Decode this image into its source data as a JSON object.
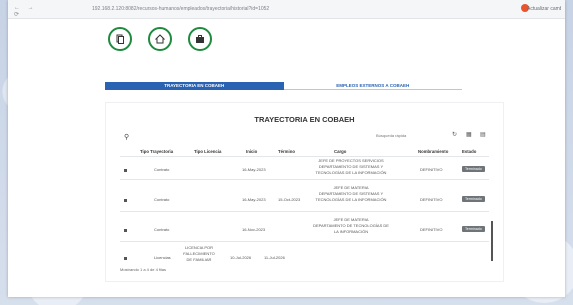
{
  "browser": {
    "nav_glyphs": "← → ⟳",
    "url": "192.168.2.120:8082/recursos-humanos/empleados/trayectoria/historial?id=1052",
    "profile_name": "Actualizar cambios"
  },
  "top_icons": [
    {
      "name": "document-icon",
      "glyph": "⎘"
    },
    {
      "name": "home-icon",
      "glyph": "⌂"
    },
    {
      "name": "briefcase-icon",
      "glyph": "▣"
    }
  ],
  "tabs": [
    {
      "label": "TRAYECTORIA EN COBAEH",
      "active": true
    },
    {
      "label": "EMPLEOS EXTERNOS A COBAEH",
      "active": false
    }
  ],
  "table_title": "TRAYECTORIA EN COBAEH",
  "search": {
    "placeholder": "Búsqueda rápida"
  },
  "columns": [
    "Tipo Trayectoria",
    "Tipo Licencia",
    "Inicio",
    "Término",
    "Cargo",
    "Nombramiento",
    "Estado"
  ],
  "rows": [
    {
      "tipo": "Contrato",
      "licencia": "",
      "inicio": "16-May-2023",
      "termino": "",
      "cargo_lines": [
        "JEFE DE PROYECTOS SERVICIOS",
        "DEPARTAMENTO DE SISTEMAS Y",
        "TECNOLOGÍAS DE LA INFORMACIÓN"
      ],
      "nombramiento": "DEFINITIVO",
      "estado": "Terminado"
    },
    {
      "tipo": "Contrato",
      "licencia": "",
      "inicio": "16-May-2023",
      "termino": "15-Oct-2023",
      "cargo_lines": [
        "JEFE DE MATERIA",
        "DEPARTAMENTO DE SISTEMAS Y",
        "TECNOLOGÍAS DE LA INFORMACIÓN"
      ],
      "nombramiento": "DEFINITIVO",
      "estado": "Terminado"
    },
    {
      "tipo": "Contrato",
      "licencia": "",
      "inicio": "16-Nov-2023",
      "termino": "",
      "cargo_lines": [
        "JEFE DE MATERIA",
        "DEPARTAMENTO DE TECNOLOGÍAS DE",
        "LA INFORMACIÓN"
      ],
      "nombramiento": "DEFINITIVO",
      "estado": "Terminado"
    },
    {
      "tipo": "Licencias",
      "licencia": "LICENCIA POR FALLECIMIENTO DE FAMILIAR",
      "licencia_lines": [
        "LICENCIA POR",
        "FALLECIMIENTO",
        "DE FAMILIAR"
      ],
      "inicio": "10-Jul-2026",
      "termino": "11-Jul-2026",
      "cargo_lines": [],
      "nombramiento": "",
      "estado": ""
    }
  ],
  "footer": "Mostrando 1 a 4 de 4 filas",
  "colors": {
    "accent": "#2b63b3",
    "icon_green": "#1f8a3e",
    "badge": "#6f7479"
  }
}
